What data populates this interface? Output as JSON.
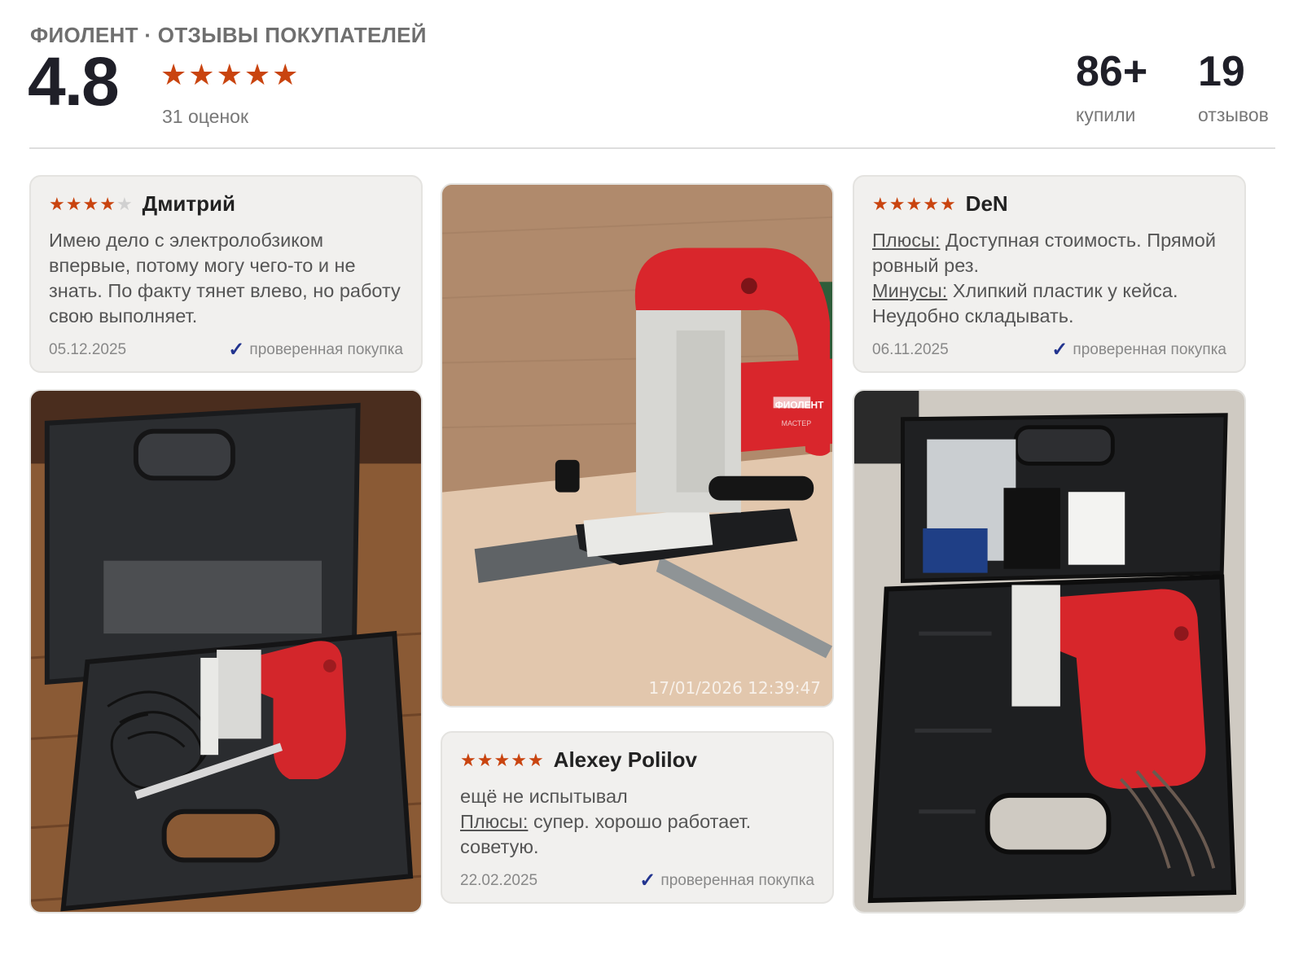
{
  "header": {
    "brand": "ФИОЛЕНТ · ОТЗЫВЫ ПОКУПАТЕЛЕЙ",
    "rating": "4.8",
    "stars": 5,
    "ratings_count": "31 оценок",
    "bought_num": "86+",
    "bought_label": "купили",
    "reviews_num": "19",
    "reviews_label": "отзывов"
  },
  "colors": {
    "star": "#c9440f",
    "star_empty": "#d0d0d0",
    "check": "#22348f"
  },
  "reviews": [
    {
      "author": "Дмитрий",
      "stars": 4,
      "text": "Имею дело с электролобзиком впервые, потому могу чего-то и не знать. По факту тянет влево, но работу свою выполняет.",
      "date": "05.12.2025",
      "verified": "проверенная покупка"
    },
    {
      "author": "DeN",
      "stars": 5,
      "pros_label": "Плюсы:",
      "pros": "Доступная стоимость. Прямой ровный рез.",
      "cons_label": "Минусы:",
      "cons": "Хлипкий пластик у кейса. Неудобно складывать.",
      "date": "06.11.2025",
      "verified": "проверенная покупка"
    },
    {
      "author": "Alexey Polilov",
      "stars": 5,
      "text": "ещё не испытывал",
      "pros_label": "Плюсы:",
      "pros": "супер. хорошо работает. советую.",
      "date": "22.02.2025",
      "verified": "проверенная покупка"
    }
  ],
  "photos": {
    "center_timestamp": "17/01/2026 12:39:47",
    "tool_brand": "ФИОЛЕНТ",
    "tool_model": "МАСТЕР"
  }
}
